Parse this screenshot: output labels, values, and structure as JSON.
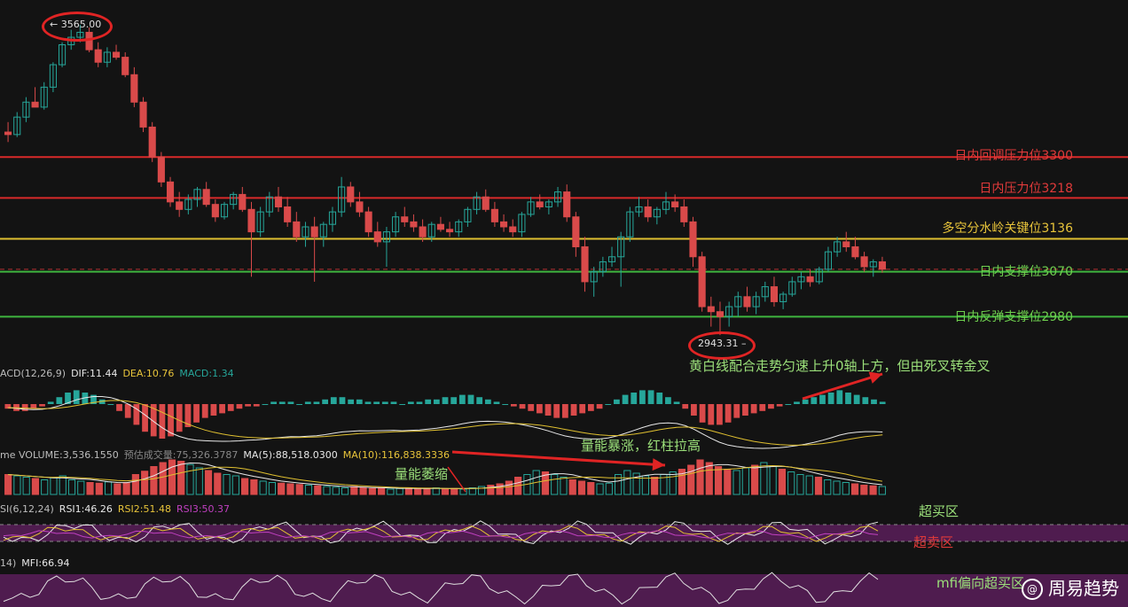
{
  "colors": {
    "background": "#131313",
    "up": "#26a69a",
    "down": "#d94a4a",
    "resistance": "#d92a2a",
    "pivot": "#e0c030",
    "support": "#3fb53f",
    "dif": "#e8e8e8",
    "dea": "#e0c030",
    "zone": "#5a1f5a"
  },
  "price_levels": [
    {
      "label": "日内回调压力位3300",
      "value": 3300,
      "color": "#e03a3a"
    },
    {
      "label": "日内压力位3218",
      "value": 3218,
      "color": "#e03a3a"
    },
    {
      "label": "多空分水岭关键位3136",
      "value": 3136,
      "color": "#e8c43a"
    },
    {
      "label": "日内支撑位3070",
      "value": 3070,
      "color": "#6fcf4f"
    },
    {
      "label": "日内反弹支撑位2980",
      "value": 2980,
      "color": "#6fcf4f"
    }
  ],
  "extremes": {
    "high_label": "← 3565.00",
    "low_label": "2943.31 –"
  },
  "macd": {
    "prefix": "ACD(12,26,9)",
    "dif": "DIF:11.44",
    "dea": "DEA:10.76",
    "macd": "MACD:1.34"
  },
  "volume": {
    "prefix": "me  VOLUME:3,536.1550",
    "estimate": "预估成交量:75,326.3787",
    "ma5": "MA(5):88,518.0300",
    "ma10": "MA(10):116,838.3336"
  },
  "rsi": {
    "prefix": "SI(6,12,24)",
    "rsi1": "RSI1:46.26",
    "rsi2": "RSI2:51.48",
    "rsi3": "RSI3:50.37"
  },
  "mfi": {
    "prefix": "14)",
    "value": "MFI:66.94"
  },
  "annotations": {
    "macd_note": "黄白线配合走势匀速上升0轴上方，但由死叉转金叉",
    "volume_surge": "量能暴涨，红柱拉高",
    "volume_shrink": "量能萎缩",
    "overbought": "超买区",
    "oversold": "超卖区",
    "mfi_note": "mfi偏向超买区"
  },
  "watermark": {
    "icon": "@",
    "text": "周易趋势"
  },
  "chart_data": {
    "type": "candlestick",
    "title": "",
    "price_range": [
      2900,
      3580
    ],
    "high": 3565.0,
    "low": 2943.31,
    "candles_ohlc": [
      [
        3350,
        3370,
        3330,
        3345
      ],
      [
        3345,
        3390,
        3340,
        3380
      ],
      [
        3380,
        3420,
        3370,
        3410
      ],
      [
        3410,
        3440,
        3400,
        3400
      ],
      [
        3400,
        3450,
        3395,
        3440
      ],
      [
        3440,
        3490,
        3430,
        3485
      ],
      [
        3485,
        3530,
        3480,
        3525
      ],
      [
        3525,
        3555,
        3515,
        3540
      ],
      [
        3540,
        3565,
        3530,
        3550
      ],
      [
        3550,
        3560,
        3510,
        3515
      ],
      [
        3515,
        3530,
        3480,
        3490
      ],
      [
        3490,
        3520,
        3480,
        3510
      ],
      [
        3510,
        3525,
        3495,
        3500
      ],
      [
        3500,
        3510,
        3460,
        3465
      ],
      [
        3465,
        3480,
        3400,
        3410
      ],
      [
        3410,
        3420,
        3350,
        3360
      ],
      [
        3360,
        3370,
        3290,
        3300
      ],
      [
        3300,
        3310,
        3240,
        3250
      ],
      [
        3250,
        3260,
        3200,
        3210
      ],
      [
        3210,
        3230,
        3180,
        3195
      ],
      [
        3195,
        3225,
        3185,
        3215
      ],
      [
        3215,
        3240,
        3200,
        3235
      ],
      [
        3235,
        3250,
        3200,
        3205
      ],
      [
        3205,
        3215,
        3170,
        3180
      ],
      [
        3180,
        3210,
        3175,
        3205
      ],
      [
        3205,
        3230,
        3195,
        3225
      ],
      [
        3225,
        3240,
        3190,
        3195
      ],
      [
        3195,
        3210,
        3060,
        3150
      ],
      [
        3150,
        3200,
        3140,
        3190
      ],
      [
        3190,
        3230,
        3180,
        3220
      ],
      [
        3220,
        3240,
        3190,
        3200
      ],
      [
        3200,
        3220,
        3160,
        3170
      ],
      [
        3170,
        3190,
        3130,
        3140
      ],
      [
        3140,
        3170,
        3120,
        3160
      ],
      [
        3160,
        3180,
        3050,
        3140
      ],
      [
        3140,
        3170,
        3120,
        3165
      ],
      [
        3165,
        3200,
        3150,
        3190
      ],
      [
        3190,
        3260,
        3180,
        3240
      ],
      [
        3240,
        3250,
        3200,
        3210
      ],
      [
        3210,
        3230,
        3180,
        3190
      ],
      [
        3190,
        3200,
        3140,
        3150
      ],
      [
        3150,
        3170,
        3120,
        3130
      ],
      [
        3130,
        3160,
        3080,
        3150
      ],
      [
        3150,
        3190,
        3140,
        3180
      ],
      [
        3180,
        3200,
        3160,
        3170
      ],
      [
        3170,
        3185,
        3150,
        3160
      ],
      [
        3160,
        3175,
        3130,
        3140
      ],
      [
        3140,
        3170,
        3130,
        3165
      ],
      [
        3165,
        3180,
        3150,
        3155
      ],
      [
        3155,
        3170,
        3140,
        3150
      ],
      [
        3150,
        3175,
        3140,
        3170
      ],
      [
        3170,
        3200,
        3160,
        3195
      ],
      [
        3195,
        3230,
        3185,
        3220
      ],
      [
        3220,
        3235,
        3190,
        3195
      ],
      [
        3195,
        3210,
        3160,
        3170
      ],
      [
        3170,
        3185,
        3150,
        3160
      ],
      [
        3160,
        3175,
        3140,
        3150
      ],
      [
        3150,
        3190,
        3140,
        3185
      ],
      [
        3185,
        3220,
        3180,
        3210
      ],
      [
        3210,
        3225,
        3195,
        3200
      ],
      [
        3200,
        3215,
        3185,
        3210
      ],
      [
        3210,
        3240,
        3200,
        3230
      ],
      [
        3230,
        3245,
        3170,
        3180
      ],
      [
        3180,
        3190,
        3100,
        3120
      ],
      [
        3120,
        3140,
        3030,
        3050
      ],
      [
        3050,
        3080,
        3020,
        3070
      ],
      [
        3070,
        3100,
        3060,
        3090
      ],
      [
        3090,
        3120,
        3080,
        3100
      ],
      [
        3100,
        3150,
        3040,
        3140
      ],
      [
        3140,
        3200,
        3130,
        3190
      ],
      [
        3190,
        3220,
        3180,
        3200
      ],
      [
        3200,
        3215,
        3170,
        3180
      ],
      [
        3180,
        3200,
        3165,
        3195
      ],
      [
        3195,
        3230,
        3185,
        3210
      ],
      [
        3210,
        3225,
        3190,
        3200
      ],
      [
        3200,
        3215,
        3160,
        3170
      ],
      [
        3170,
        3180,
        3080,
        3100
      ],
      [
        3100,
        3110,
        2990,
        3000
      ],
      [
        3000,
        3020,
        2960,
        2990
      ],
      [
        2990,
        3010,
        2943,
        2980
      ],
      [
        2980,
        3010,
        2960,
        3000
      ],
      [
        3000,
        3030,
        2980,
        3020
      ],
      [
        3020,
        3040,
        2990,
        3000
      ],
      [
        3000,
        3030,
        2985,
        3020
      ],
      [
        3020,
        3050,
        3010,
        3040
      ],
      [
        3040,
        3060,
        3000,
        3010
      ],
      [
        3010,
        3030,
        2995,
        3025
      ],
      [
        3025,
        3060,
        3020,
        3050
      ],
      [
        3050,
        3070,
        3035,
        3060
      ],
      [
        3060,
        3075,
        3040,
        3050
      ],
      [
        3050,
        3080,
        3045,
        3075
      ],
      [
        3075,
        3120,
        3070,
        3110
      ],
      [
        3110,
        3140,
        3100,
        3130
      ],
      [
        3130,
        3150,
        3110,
        3120
      ],
      [
        3120,
        3140,
        3095,
        3100
      ],
      [
        3100,
        3110,
        3070,
        3080
      ],
      [
        3080,
        3095,
        3060,
        3090
      ],
      [
        3090,
        3100,
        3068,
        3075
      ]
    ],
    "volume_values": [
      30,
      28,
      26,
      24,
      22,
      25,
      28,
      22,
      20,
      18,
      17,
      19,
      16,
      18,
      30,
      35,
      42,
      48,
      52,
      50,
      45,
      40,
      36,
      32,
      30,
      28,
      24,
      22,
      20,
      18,
      17,
      16,
      15,
      14,
      13,
      12,
      11,
      10,
      12,
      10,
      9,
      10,
      8,
      9,
      10,
      8,
      9,
      10,
      8,
      9,
      8,
      10,
      12,
      14,
      16,
      20,
      26,
      30,
      36,
      34,
      30,
      26,
      22,
      20,
      18,
      16,
      17,
      30,
      36,
      32,
      28,
      26,
      30,
      34,
      38,
      44,
      52,
      48,
      42,
      38,
      36,
      40,
      44,
      48,
      42,
      38,
      34,
      30,
      28,
      26,
      22,
      20,
      18,
      16,
      14,
      13,
      12
    ],
    "macd_hist": [
      -2,
      -3,
      -3,
      -2,
      -1,
      1,
      3,
      5,
      6,
      5,
      4,
      2,
      0,
      -3,
      -6,
      -9,
      -12,
      -14,
      -15,
      -14,
      -12,
      -10,
      -8,
      -6,
      -5,
      -4,
      -3,
      -2,
      -1,
      -1,
      0,
      1,
      1,
      1,
      0,
      1,
      1,
      2,
      3,
      3,
      2,
      2,
      1,
      1,
      1,
      1,
      0,
      1,
      1,
      2,
      2,
      3,
      3,
      4,
      4,
      3,
      2,
      1,
      0,
      -1,
      -2,
      -3,
      -4,
      -5,
      -6,
      -6,
      -5,
      -4,
      -3,
      -2,
      0,
      2,
      4,
      5,
      6,
      6,
      5,
      3,
      1,
      -2,
      -5,
      -8,
      -9,
      -9,
      -8,
      -6,
      -5,
      -4,
      -3,
      -2,
      -1,
      0,
      1,
      2,
      3,
      4,
      5,
      6,
      5,
      4,
      3,
      2,
      1
    ],
    "levels": [
      3300,
      3218,
      3136,
      3070,
      2980
    ]
  }
}
